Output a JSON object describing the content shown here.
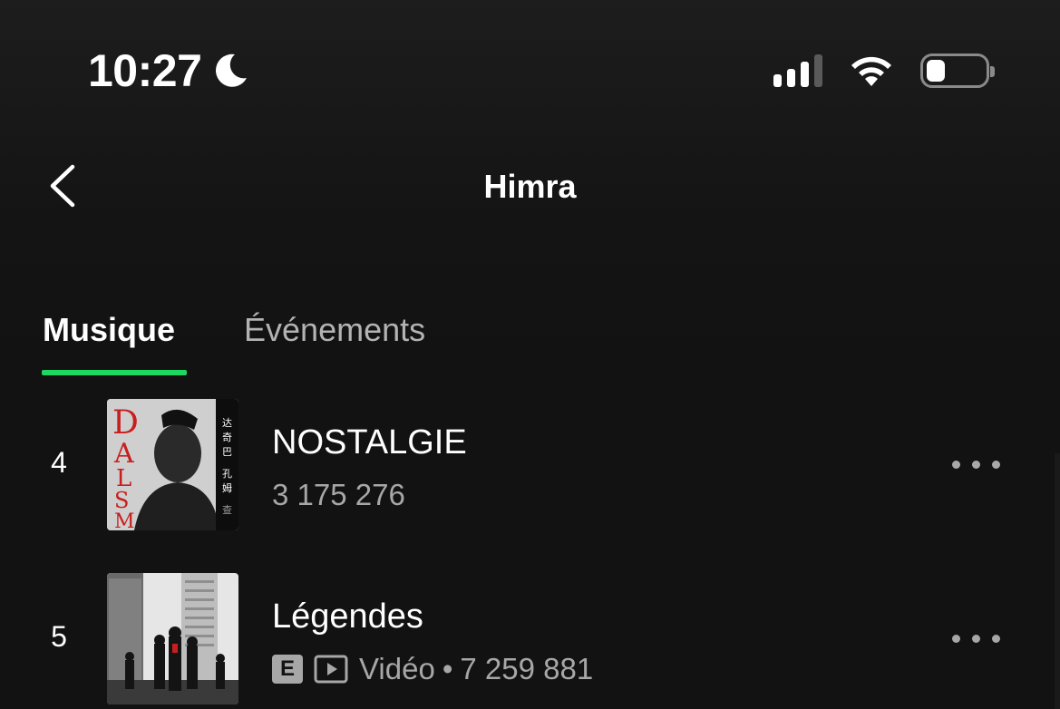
{
  "status_bar": {
    "time": "10:27",
    "focus_icon": "moon-icon",
    "signal_bars": 4,
    "signal_active": 3,
    "battery_percent": 20
  },
  "header": {
    "back_icon": "chevron-left-icon",
    "title": "Himra"
  },
  "tabs": [
    {
      "label": "Musique",
      "active": true
    },
    {
      "label": "Événements",
      "active": false
    }
  ],
  "colors": {
    "accent": "#1ed760",
    "background": "#121212",
    "secondary_text": "#a7a7a7"
  },
  "tracks": [
    {
      "rank": "4",
      "title": "NOSTALGIE",
      "plays": "3 175 276",
      "cover_text": "DALSIM",
      "cover_side_text": "达奇巴 · 孔姆巴 · 查伊巴",
      "explicit": false,
      "video": false
    },
    {
      "rank": "5",
      "title": "Légendes",
      "explicit_badge": "E",
      "video_label": "Vidéo",
      "separator": "•",
      "plays": "7 259 881",
      "explicit": true,
      "video": true
    }
  ]
}
